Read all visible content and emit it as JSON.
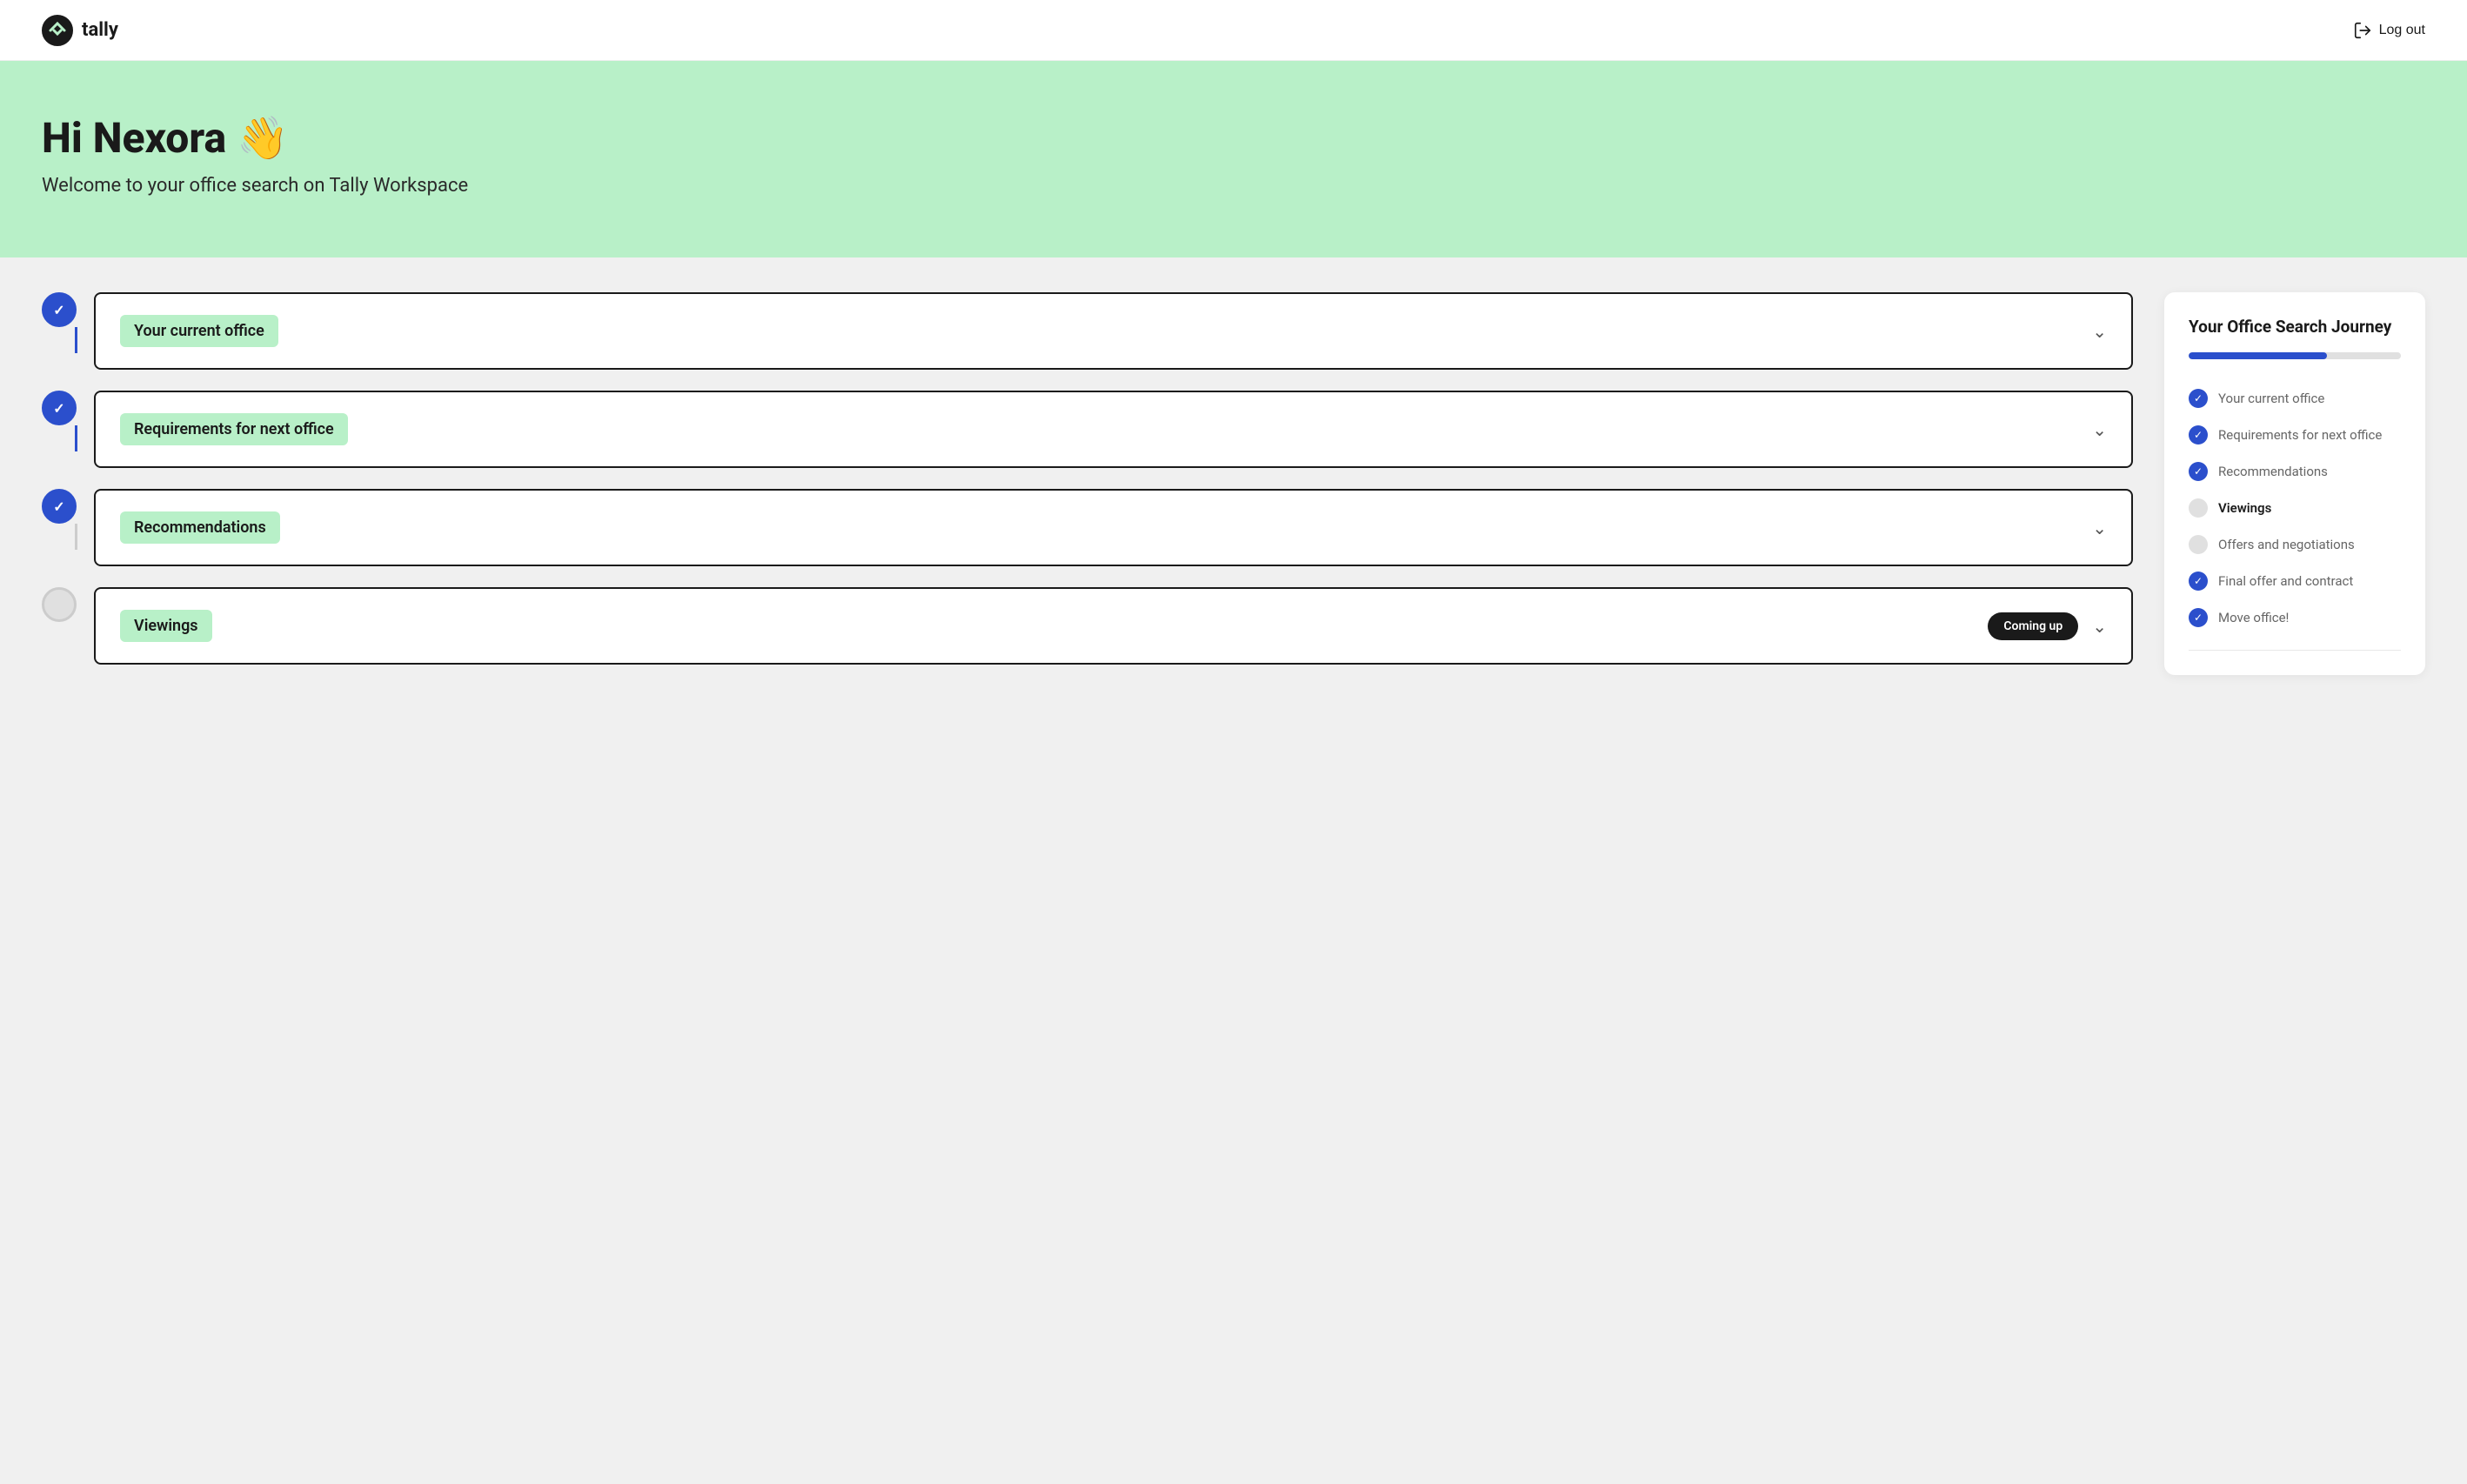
{
  "header": {
    "logo_text": "tally",
    "logout_label": "Log out"
  },
  "hero": {
    "greeting": "Hi Nexora 👋",
    "subtitle": "Welcome to your office search on Tally Workspace"
  },
  "steps": [
    {
      "id": "current-office",
      "label": "Your current office",
      "status": "completed",
      "has_coming_up": false
    },
    {
      "id": "requirements",
      "label": "Requirements for next office",
      "status": "completed",
      "has_coming_up": false
    },
    {
      "id": "recommendations",
      "label": "Recommendations",
      "status": "completed",
      "has_coming_up": false
    },
    {
      "id": "viewings",
      "label": "Viewings",
      "status": "pending",
      "has_coming_up": true,
      "coming_up_label": "Coming up"
    }
  ],
  "journey": {
    "title": "Your Office Search Journey",
    "progress_percent": 65,
    "items": [
      {
        "label": "Your current office",
        "status": "completed"
      },
      {
        "label": "Requirements for next office",
        "status": "completed"
      },
      {
        "label": "Recommendations",
        "status": "completed"
      },
      {
        "label": "Viewings",
        "status": "active"
      },
      {
        "label": "Offers and negotiations",
        "status": "pending"
      },
      {
        "label": "Final offer and contract",
        "status": "completed"
      },
      {
        "label": "Move office!",
        "status": "completed"
      }
    ]
  }
}
